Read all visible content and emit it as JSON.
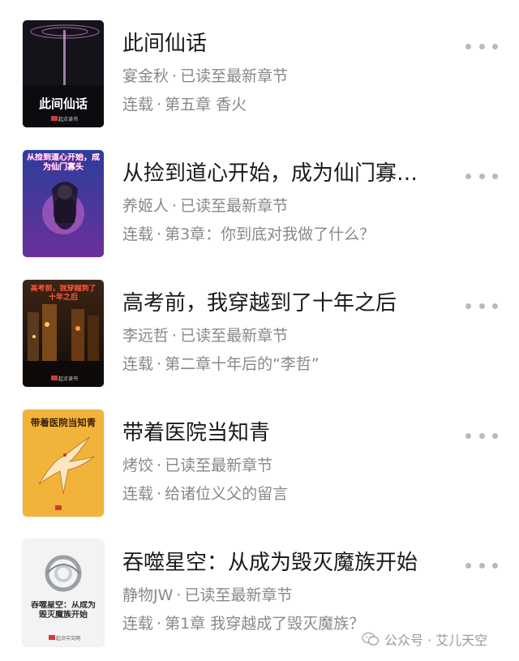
{
  "books": [
    {
      "title": "此间仙话",
      "author": "宴金秋",
      "read_status": "已读至最新章节",
      "serial_status": "连载",
      "latest_chapter": "第五章 香火",
      "cover_text": "此间仙话",
      "cover_publisher": "起点读书",
      "cover_bg": "#15121a"
    },
    {
      "title": "从捡到道心开始，成为仙门寡…",
      "author": "养姬人",
      "read_status": "已读至最新章节",
      "serial_status": "连载",
      "latest_chapter": "第3章：你到底对我做了什么？",
      "cover_text": "从捡到道心开始，成为仙门寡头",
      "cover_bg": "#4a2f8f"
    },
    {
      "title": "高考前，我穿越到了十年之后",
      "author": "李远哲",
      "read_status": "已读至最新章节",
      "serial_status": "连载",
      "latest_chapter": "第二章十年后的“李哲”",
      "cover_text": "高考前，我穿越到了十年之后",
      "cover_publisher": "起点读书",
      "cover_bg": "#2b1b10"
    },
    {
      "title": "带着医院当知青",
      "author": "烤饺",
      "read_status": "已读至最新章节",
      "serial_status": "连载",
      "latest_chapter": "给诸位义父的留言",
      "cover_text": "带着医院当知青",
      "cover_bg": "#f2b33a"
    },
    {
      "title": "吞噬星空：从成为毁灭魔族开始",
      "author": "静物JW",
      "read_status": "已读至最新章节",
      "serial_status": "连载",
      "latest_chapter": "第1章 我穿越成了毁灭魔族？",
      "cover_text": "吞噬星空：从成为毁灭魔族开始",
      "cover_publisher": "起点中文网",
      "cover_bg": "#f3f3f3"
    }
  ],
  "separator": "·",
  "more_icon": "ellipsis-icon",
  "watermark": {
    "icon": "wechat-icon",
    "text": "公众号 · 艾儿天空"
  }
}
